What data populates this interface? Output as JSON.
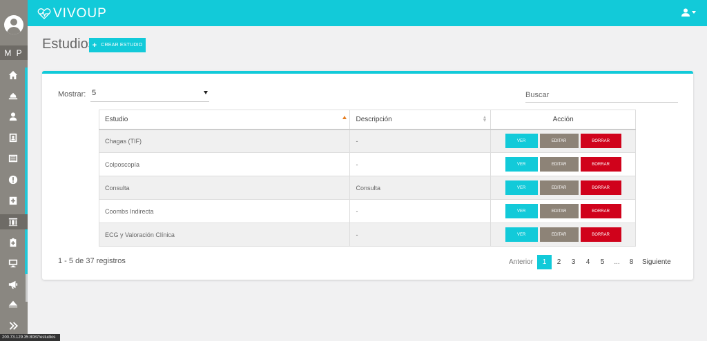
{
  "app": {
    "logo_text": "VIVOUP"
  },
  "sidebar": {
    "initials": "M P",
    "items": [
      {
        "icon": "home-icon"
      },
      {
        "icon": "bell-icon"
      },
      {
        "icon": "user-md-icon"
      },
      {
        "icon": "address-book-icon"
      },
      {
        "icon": "list-icon"
      },
      {
        "icon": "alert-icon"
      },
      {
        "icon": "medkit-icon"
      },
      {
        "icon": "building-icon"
      },
      {
        "icon": "clipboard-icon"
      },
      {
        "icon": "monitor-icon"
      },
      {
        "icon": "megaphone-icon"
      },
      {
        "icon": "eject-icon"
      },
      {
        "icon": "expand-icon"
      }
    ]
  },
  "page": {
    "title": "Estudios",
    "create_button": "CREAR ESTUDIO"
  },
  "controls": {
    "show_label": "Mostrar:",
    "show_value": "5",
    "search_placeholder": "Buscar"
  },
  "table": {
    "headers": {
      "study": "Estudio",
      "description": "Descripción",
      "action": "Acción"
    },
    "button_labels": {
      "view": "VER",
      "edit": "EDITAR",
      "delete": "BORRAR"
    },
    "rows": [
      {
        "study": "Chagas (TIF)",
        "description": "-"
      },
      {
        "study": "Colposcopía",
        "description": "-"
      },
      {
        "study": "Consulta",
        "description": "Consulta"
      },
      {
        "study": "Coombs Indirecta",
        "description": "-"
      },
      {
        "study": "ECG y Valoración Clínica",
        "description": "-"
      }
    ]
  },
  "footer": {
    "records_info": "1 - 5 de 37 registros",
    "pager": {
      "previous": "Anterior",
      "pages": [
        "1",
        "2",
        "3",
        "4",
        "5",
        "...",
        "8"
      ],
      "active": "1",
      "next": "Siguiente"
    }
  },
  "statusbar": {
    "url": "200.73.129.35:8087/estudios"
  },
  "colors": {
    "accent": "#12cad9",
    "edit": "#8d8377",
    "delete": "#d0021b",
    "sidebar": "#8a8781"
  }
}
